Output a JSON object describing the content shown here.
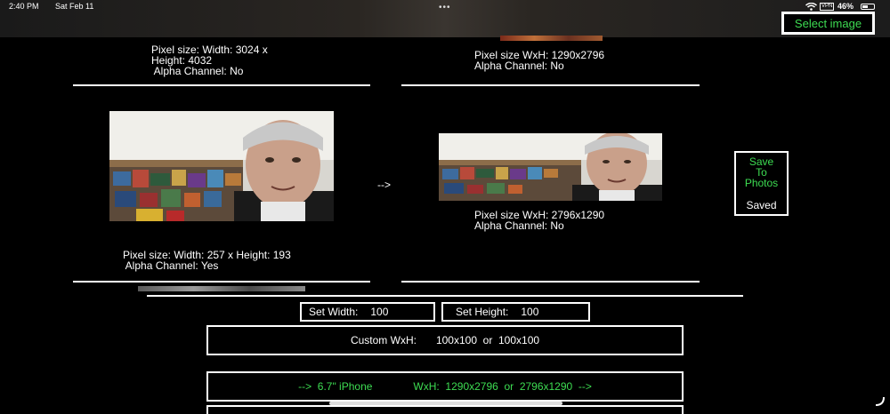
{
  "status": {
    "time": "2:40 PM",
    "date": "Sat Feb 11",
    "multitask_dots": "•••",
    "vpn": "VPN",
    "battery": "46%"
  },
  "toolbar": {
    "select_image": "Select image"
  },
  "top_left": {
    "line1": "Pixel size: Width: 3024 x",
    "line2": "Height: 4032",
    "line3": " Alpha Channel: No"
  },
  "top_right": {
    "line1": "Pixel size WxH: 1290x2796",
    "line2": "Alpha Channel: No"
  },
  "middle_left": {
    "line1": "Pixel size: Width: 257 x Height: 193",
    "line2": " Alpha Channel: Yes"
  },
  "arrow": "-->",
  "middle_right": {
    "line1": "Pixel size WxH: 2796x1290",
    "line2": "Alpha Channel: No"
  },
  "save_panel": {
    "line1": "Save",
    "line2": "To",
    "line3": "Photos",
    "status": "Saved"
  },
  "controls": {
    "set_width_label": "Set Width:",
    "set_width_value": "100",
    "set_height_label": "Set Height:",
    "set_height_value": "100",
    "custom_label": "Custom WxH:",
    "custom_value": "100x100  or  100x100",
    "preset_device": "-->  6.7\" iPhone",
    "preset_size": "WxH:  1290x2796  or  2796x1290  -->"
  }
}
